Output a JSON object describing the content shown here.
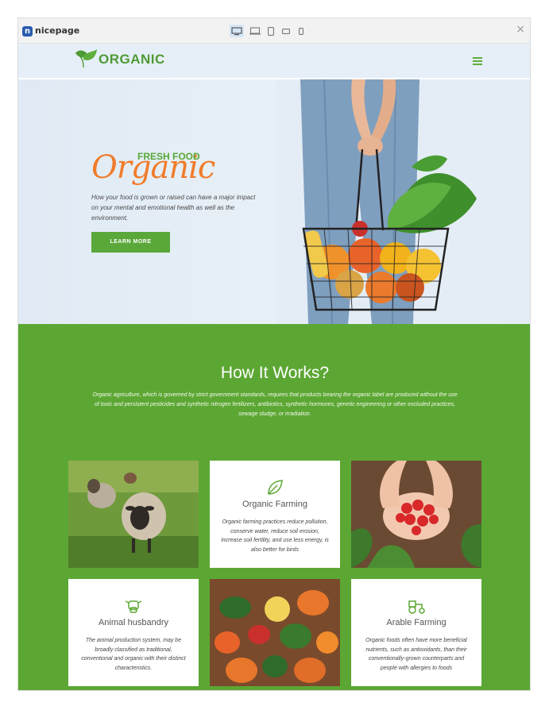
{
  "builder": {
    "brand": "nicepage",
    "brand_badge": "n",
    "close_symbol": "×",
    "devices": [
      {
        "name": "desktop",
        "active": true
      },
      {
        "name": "laptop",
        "active": false
      },
      {
        "name": "tablet",
        "active": false
      },
      {
        "name": "phone-landscape",
        "active": false
      },
      {
        "name": "phone",
        "active": false
      }
    ]
  },
  "site": {
    "brand_name": "ORGANIC",
    "accent_green": "#5ca733",
    "accent_orange": "#f07c2b"
  },
  "hero": {
    "subtitle": "FRESH FOOD",
    "script_title": "Organic",
    "description": "How your food is grown or raised can have a major impact on your mental and emotional health as well as the environment.",
    "button_label": "LEARN MORE"
  },
  "how": {
    "title": "How It Works?",
    "description": "Organic agriculture, which is governed by strict government standards, requires that products bearing the organic label are produced without the use of toxic and persistent pesticides and synthetic nitrogen fertilizers, antibiotics, synthetic hormones, genetic engineering or other excluded practices, sewage sludge, or irradiation.",
    "cards": [
      {
        "icon": "leaf-icon",
        "title": "Organic Farming",
        "text": "Organic farming practices reduce pollution, conserve water, reduce soil erosion, increase soil fertility, and use less energy, is also better for birds"
      },
      {
        "icon": "cow-icon",
        "title": "Animal husbandry",
        "text": "The animal production system, may be broadly classified as traditional, conventional and organic with their distinct characteristics."
      },
      {
        "icon": "tractor-icon",
        "title": "Arable Farming",
        "text": "Organic foods often have more beneficial nutrients, such as antioxidants, than their conventionally-grown counterparts and people with allergies to foods"
      }
    ],
    "photos": [
      "sheep-photo",
      "strawberries-photo",
      "vegetables-photo"
    ]
  }
}
